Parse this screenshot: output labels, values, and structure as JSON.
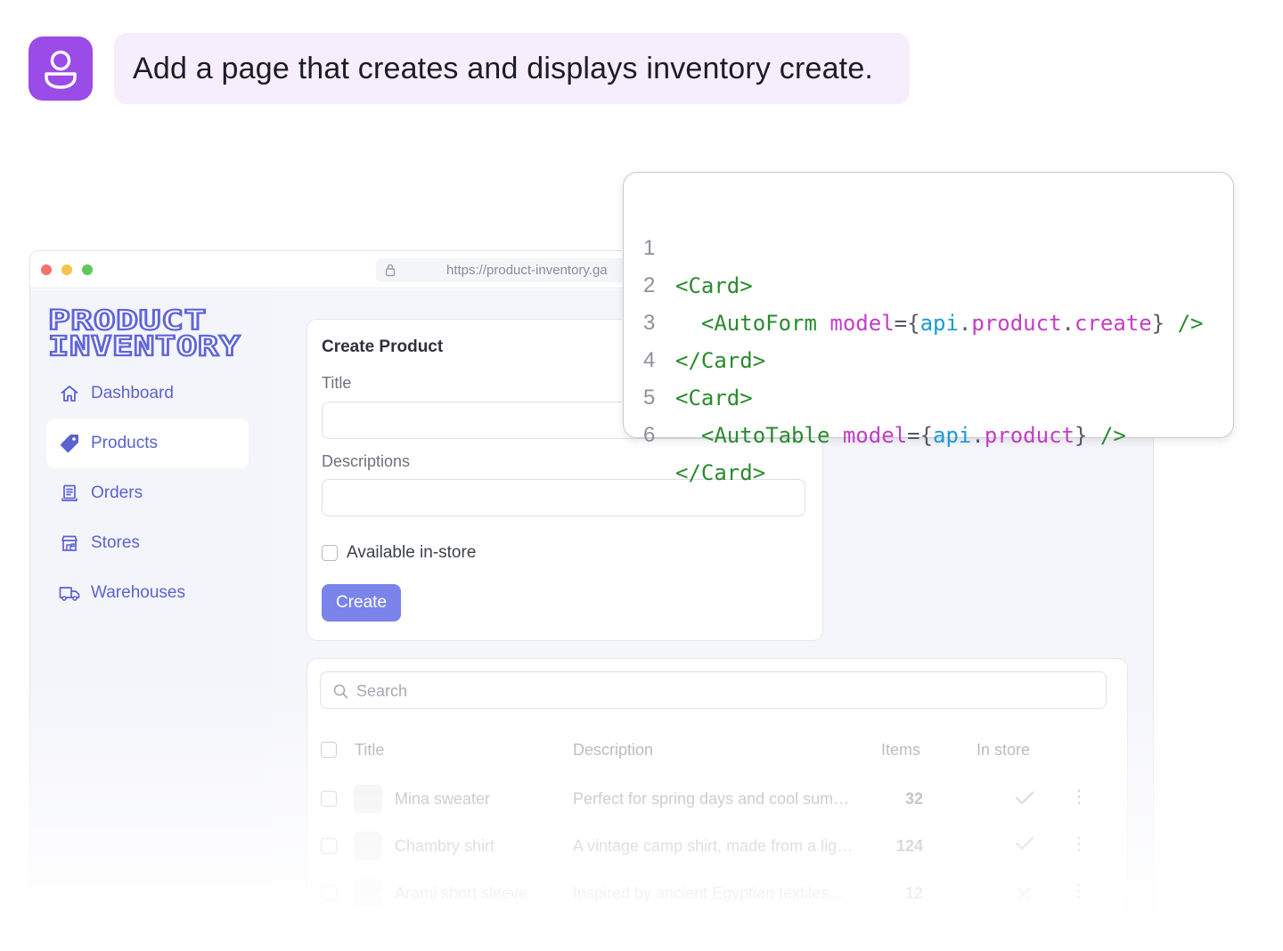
{
  "prompt": {
    "text": "Add a page that creates and displays inventory create."
  },
  "browser": {
    "url": "https://product-inventory.ga"
  },
  "sidebar": {
    "logo_line1": "PRODUCT",
    "logo_line2": "INVENTORY",
    "items": [
      {
        "label": "Dashboard",
        "icon": "home-icon",
        "active": false
      },
      {
        "label": "Products",
        "icon": "tag-icon",
        "active": true
      },
      {
        "label": "Orders",
        "icon": "receipt-icon",
        "active": false
      },
      {
        "label": "Stores",
        "icon": "store-icon",
        "active": false
      },
      {
        "label": "Warehouses",
        "icon": "truck-icon",
        "active": false
      }
    ]
  },
  "form": {
    "title": "Create Product",
    "title_label": "Title",
    "title_value": "",
    "description_label": "Descriptions",
    "description_value": "",
    "checkbox_label": "Available in-store",
    "checkbox_checked": false,
    "submit_label": "Create"
  },
  "table": {
    "search_placeholder": "Search",
    "columns": [
      "Title",
      "Description",
      "Items",
      "In store"
    ],
    "rows": [
      {
        "title": "Mina sweater",
        "description": "Perfect for spring days and cool sum…",
        "items": "32",
        "in_store": true
      },
      {
        "title": "Chambry shirt",
        "description": "A vintage camp shirt, made from a lig…",
        "items": "124",
        "in_store": true
      },
      {
        "title": "Arami short sleeve",
        "description": "Inspired by ancient Egyptian textiles…",
        "items": "12",
        "in_store": false
      }
    ]
  },
  "code": {
    "lines": [
      {
        "n": "1",
        "indent": "",
        "tag": "<Card>"
      },
      {
        "n": "2",
        "indent": "  ",
        "tag": "<AutoForm",
        "attr": "model",
        "api": "api",
        "path": [
          "product",
          "create"
        ],
        "close": "/>"
      },
      {
        "n": "3",
        "indent": "",
        "tag": "</Card>"
      },
      {
        "n": "4",
        "indent": "",
        "tag": "<Card>"
      },
      {
        "n": "5",
        "indent": "  ",
        "tag": "<AutoTable",
        "attr": "model",
        "api": "api",
        "path": [
          "product"
        ],
        "close": "/>"
      },
      {
        "n": "6",
        "indent": "",
        "tag": "</Card>"
      }
    ]
  },
  "colors": {
    "avatar": "#9b4be8",
    "prompt_bubble": "#f6eefd",
    "accent": "#7b84ea",
    "nav_text": "#5b62cf",
    "code_tag": "#2a8a2f",
    "code_attr": "#c13fc4",
    "code_api": "#1c9ad6"
  }
}
